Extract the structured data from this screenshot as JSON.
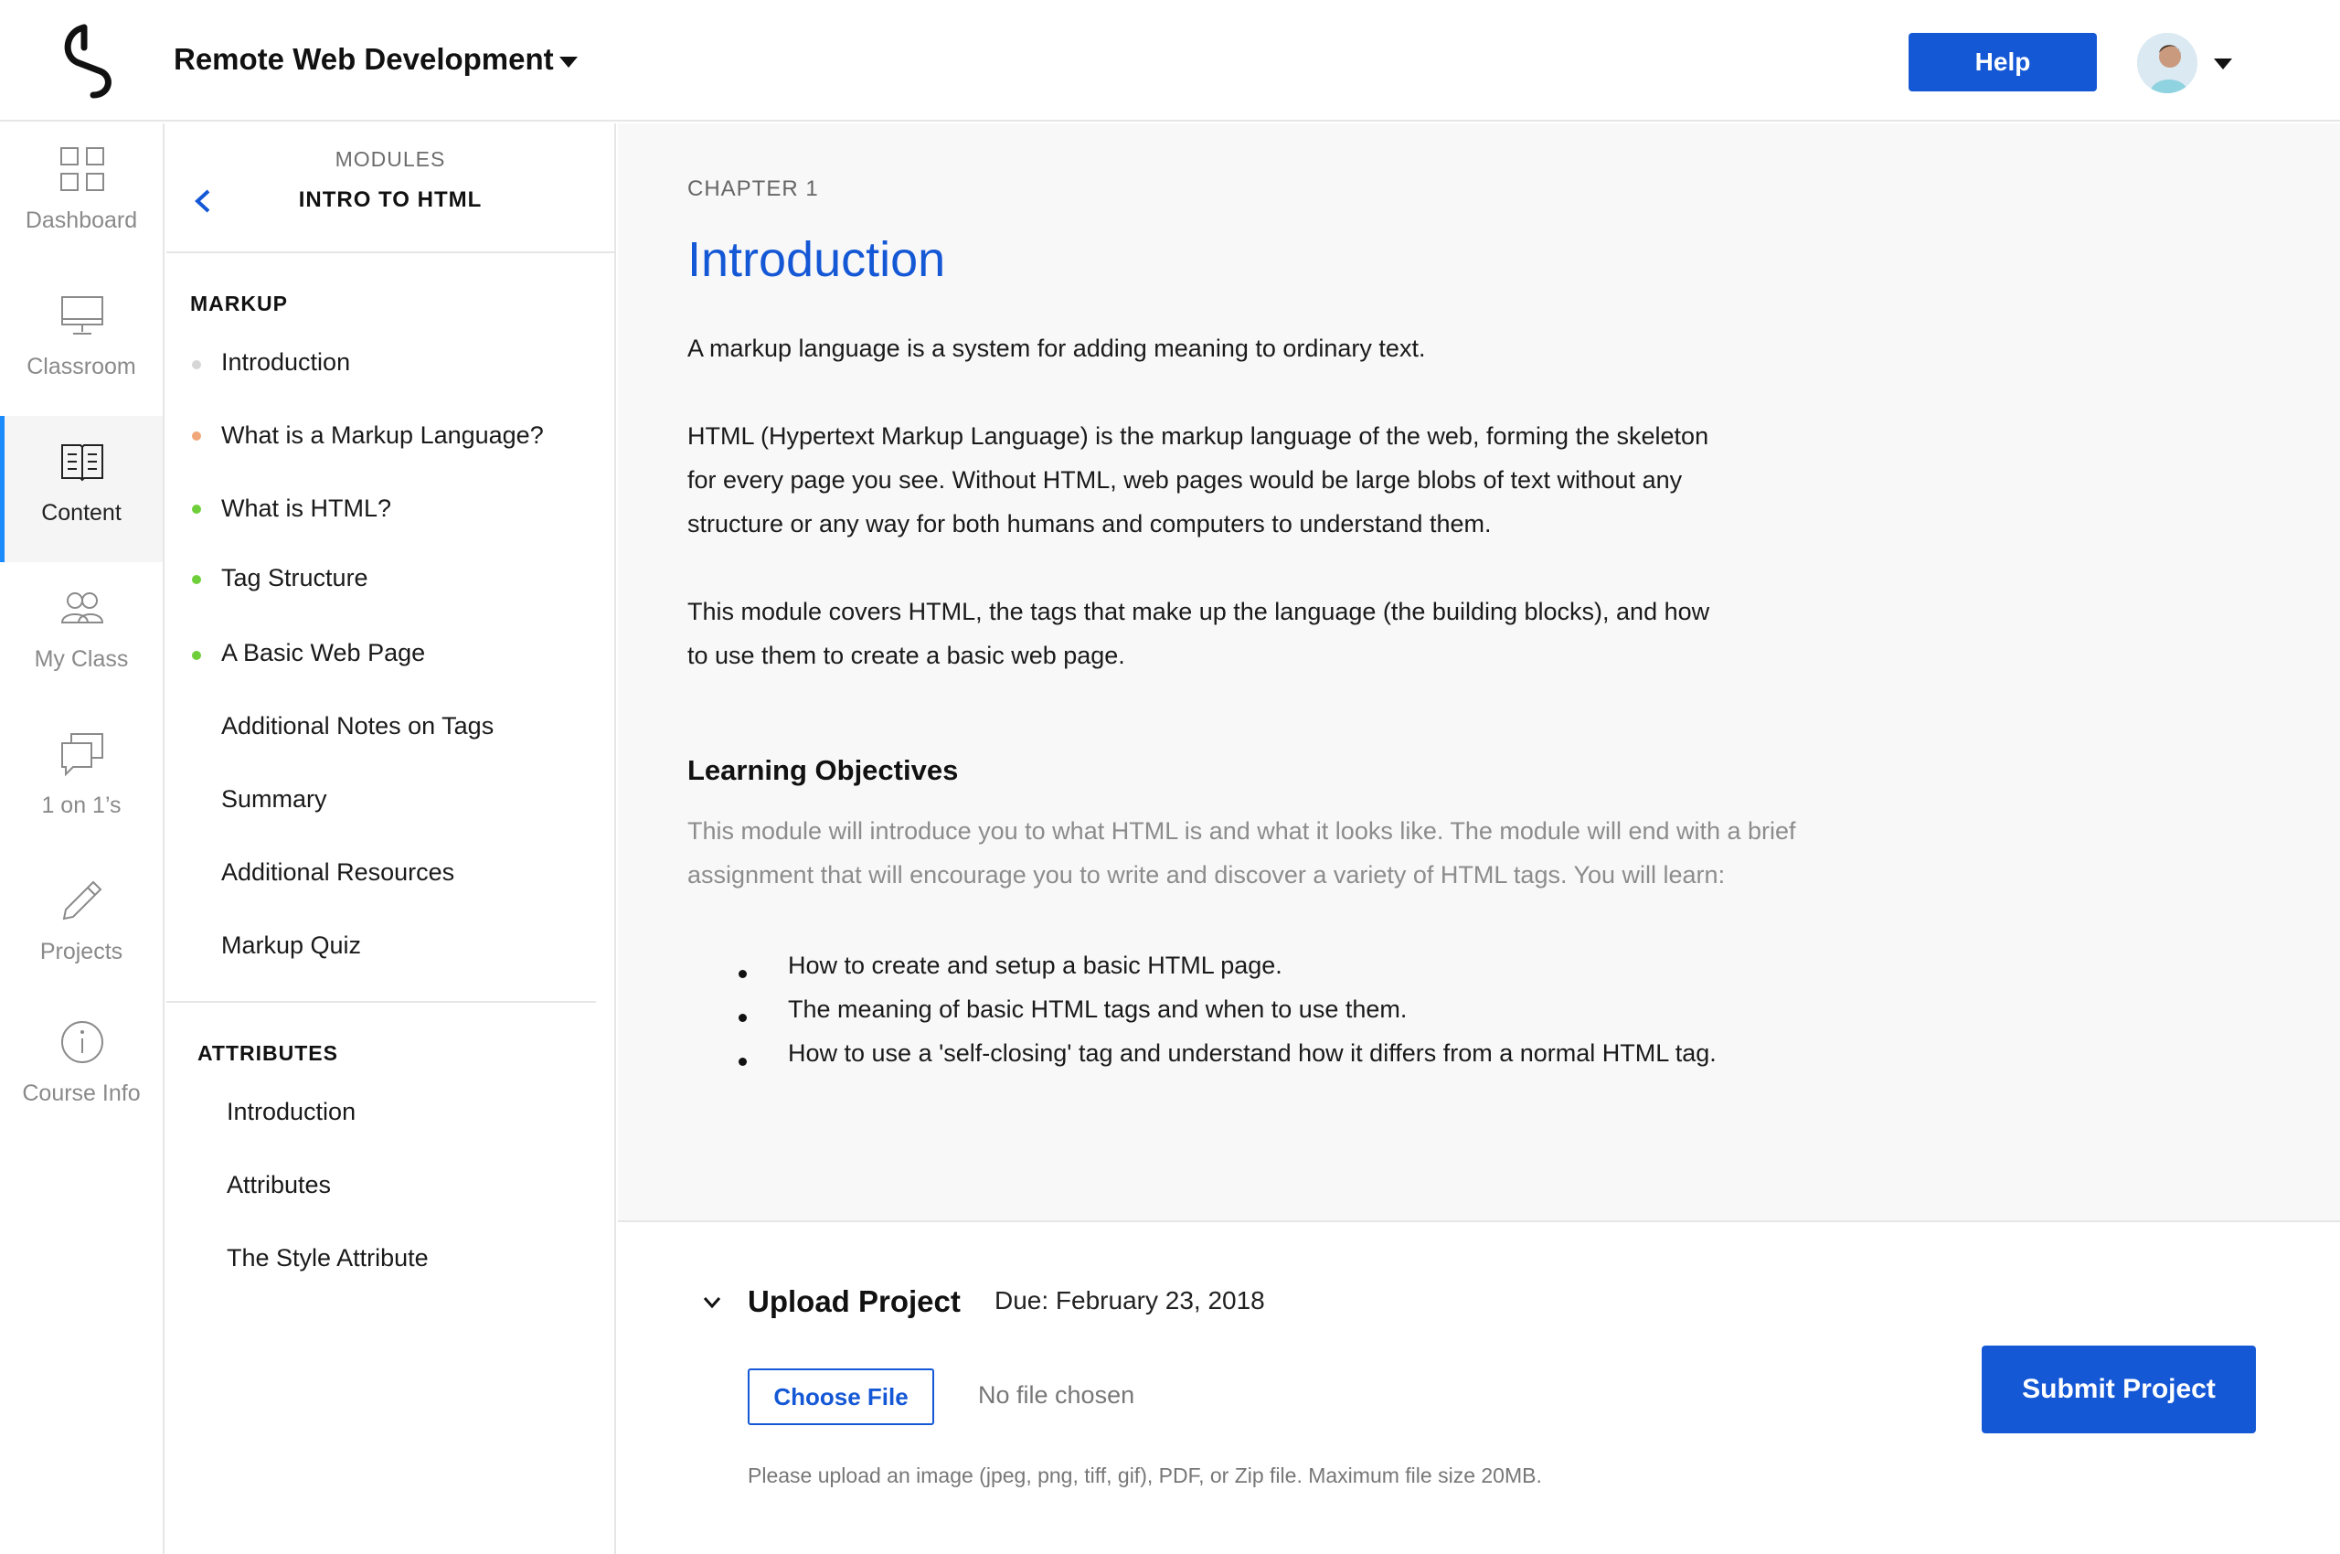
{
  "header": {
    "course_title": "Remote Web Development",
    "help_label": "Help",
    "brand_color": "#1458d6"
  },
  "rail": {
    "items": [
      {
        "label": "Dashboard",
        "icon": "grid-icon"
      },
      {
        "label": "Classroom",
        "icon": "monitor-icon"
      },
      {
        "label": "Content",
        "icon": "book-icon",
        "active": true
      },
      {
        "label": "My Class",
        "icon": "people-icon"
      },
      {
        "label": "1 on 1’s",
        "icon": "chat-icon"
      },
      {
        "label": "Projects",
        "icon": "pencil-icon"
      },
      {
        "label": "Course Info",
        "icon": "info-icon"
      }
    ]
  },
  "modules": {
    "label": "MODULES",
    "name": "INTRO TO HTML",
    "sections": [
      {
        "title": "MARKUP",
        "lessons": [
          {
            "label": "Introduction",
            "status": "gray",
            "color": "#d6d6d6"
          },
          {
            "label": "What is a Markup Language?",
            "status": "orange",
            "color": "#f0a878"
          },
          {
            "label": "What is HTML?",
            "status": "green",
            "color": "#6fcf3a"
          },
          {
            "label": "Tag Structure",
            "status": "green",
            "color": "#6fcf3a"
          },
          {
            "label": "A Basic Web Page",
            "status": "green",
            "color": "#6fcf3a"
          },
          {
            "label": "Additional Notes on Tags",
            "status": "none"
          },
          {
            "label": "Summary",
            "status": "none"
          },
          {
            "label": "Additional Resources",
            "status": "none"
          },
          {
            "label": "Markup Quiz",
            "status": "none"
          }
        ]
      },
      {
        "title": "ATTRIBUTES",
        "lessons": [
          {
            "label": "Introduction",
            "status": "none"
          },
          {
            "label": "Attributes",
            "status": "none"
          },
          {
            "label": "The Style Attribute",
            "status": "none"
          }
        ]
      }
    ]
  },
  "content": {
    "chapter": "CHAPTER 1",
    "title": "Introduction",
    "paragraphs": [
      "A markup language is a system for adding meaning to ordinary text.",
      "HTML (Hypertext Markup Language) is the markup language of the web, forming the skeleton for every page you see. Without HTML, web pages would be large blobs of text without any structure or any way for both humans and computers to understand them.",
      "This module covers HTML, the tags that make up the language (the building blocks), and how to use them to create a basic web page."
    ],
    "objectives_title": "Learning Objectives",
    "objectives_intro": "This module will introduce you to what HTML is and what it looks like. The module will end with a brief assignment that will encourage you to write and discover a variety of HTML tags. You will learn:",
    "objectives": [
      "How to create and setup a basic HTML page.",
      "The meaning of basic HTML tags and when to use them.",
      "How to use a 'self-closing' tag and understand how it differs from a normal HTML tag."
    ]
  },
  "upload": {
    "title": "Upload Project",
    "due": "Due: February 23, 2018",
    "choose_label": "Choose File",
    "no_file": "No file chosen",
    "hint": "Please upload an image (jpeg, png, tiff, gif), PDF, or Zip file. Maximum file size 20MB.",
    "submit_label": "Submit Project"
  }
}
